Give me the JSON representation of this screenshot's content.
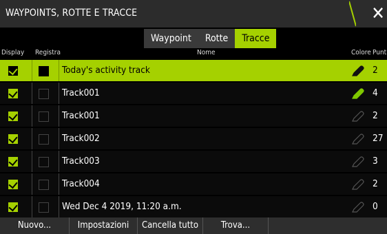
{
  "window": {
    "title": "WAYPOINTS, ROTTE E TRACCE",
    "close_label": "✕"
  },
  "tabs": [
    {
      "label": "Waypoint",
      "active": false
    },
    {
      "label": "Rotte",
      "active": false
    },
    {
      "label": "Tracce",
      "active": true
    }
  ],
  "columns": {
    "display": "Display",
    "registra": "Registra",
    "nome": "Nome",
    "colore": "Colore",
    "punti": "Punti"
  },
  "rows": [
    {
      "display": true,
      "registra": true,
      "name": "Today's activity track",
      "color": "#111111",
      "points": "2",
      "selected": true
    },
    {
      "display": true,
      "registra": false,
      "name": "Track001",
      "color": "#7fc800",
      "points": "4",
      "selected": false
    },
    {
      "display": true,
      "registra": false,
      "name": "Track001",
      "color": "#444444",
      "points": "2",
      "selected": false
    },
    {
      "display": true,
      "registra": false,
      "name": "Track002",
      "color": "#444444",
      "points": "27",
      "selected": false
    },
    {
      "display": true,
      "registra": false,
      "name": "Track003",
      "color": "#444444",
      "points": "3",
      "selected": false
    },
    {
      "display": true,
      "registra": false,
      "name": "Track004",
      "color": "#444444",
      "points": "2",
      "selected": false
    },
    {
      "display": true,
      "registra": false,
      "name": "Wed Dec 4 2019, 11:20 a.m.",
      "color": "#444444",
      "points": "0",
      "selected": false
    }
  ],
  "bottom_buttons": [
    {
      "label": "Nuovo..."
    },
    {
      "label": "Impostazioni"
    },
    {
      "label": "Cancella tutto"
    },
    {
      "label": "Trova..."
    }
  ],
  "colors": {
    "accent": "#a5d100",
    "titlebar": "#2c2c2c",
    "background": "#000000"
  }
}
